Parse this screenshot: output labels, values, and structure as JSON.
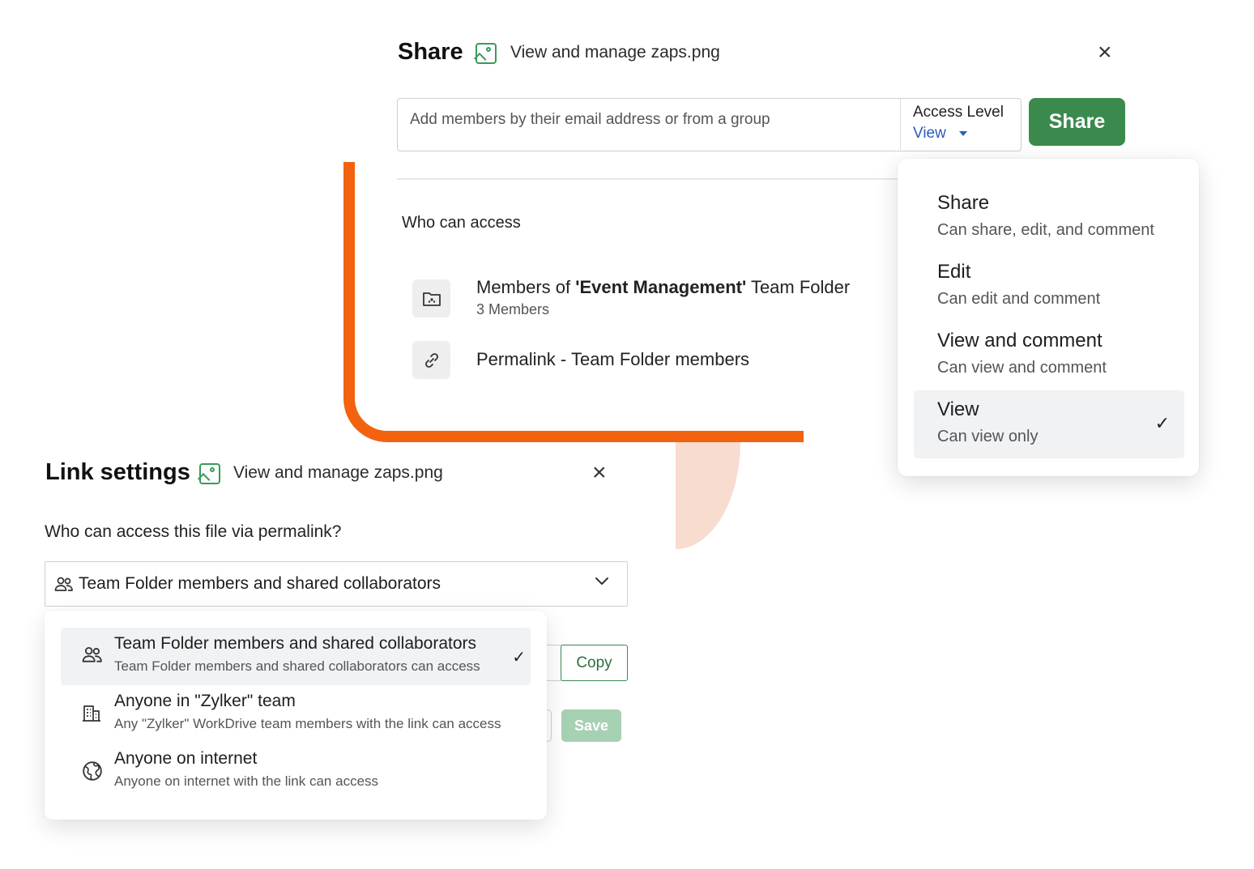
{
  "share_panel": {
    "title": "Share",
    "file_name": "View and manage zaps.png",
    "close_label": "×",
    "member_input_placeholder": "Add members by their email address or from a group",
    "access_level_label": "Access Level",
    "access_level_value": "View",
    "share_button": "Share",
    "who_can_access": "Who can access",
    "access_list": [
      {
        "title_prefix": "Members of ",
        "title_bold": "'Event Management'",
        "title_suffix": " Team Folder",
        "subtitle": "3 Members",
        "icon": "team-folder-icon"
      },
      {
        "title": "Permalink - Team Folder members",
        "icon": "link-icon"
      }
    ]
  },
  "access_level_menu": {
    "items": [
      {
        "label": "Share",
        "description": "Can share, edit, and comment",
        "selected": false
      },
      {
        "label": "Edit",
        "description": "Can edit and comment",
        "selected": false
      },
      {
        "label": "View and comment",
        "description": "Can view and comment",
        "selected": false
      },
      {
        "label": "View",
        "description": "Can view only",
        "selected": true
      }
    ],
    "check_mark": "✓"
  },
  "link_settings": {
    "title": "Link settings",
    "file_name": "View and manage zaps.png",
    "close_label": "×",
    "question": "Who can access this file via permalink?",
    "selected_option": "Team Folder members and shared collaborators",
    "copy_button": "Copy",
    "save_button": "Save",
    "options": [
      {
        "label": "Team Folder members and shared collaborators",
        "description": "Team Folder members and shared collaborators can access",
        "icon": "people-icon",
        "selected": true
      },
      {
        "label": "Anyone in \"Zylker\" team",
        "description": "Any \"Zylker\" WorkDrive team members with the link can access",
        "icon": "building-icon",
        "selected": false
      },
      {
        "label": "Anyone on internet",
        "description": "Anyone on internet with the link can access",
        "icon": "globe-icon",
        "selected": false
      }
    ]
  },
  "colors": {
    "brand_green": "#3b8a4d",
    "accent_orange": "#f2620f",
    "link_blue": "#2a5db8"
  }
}
